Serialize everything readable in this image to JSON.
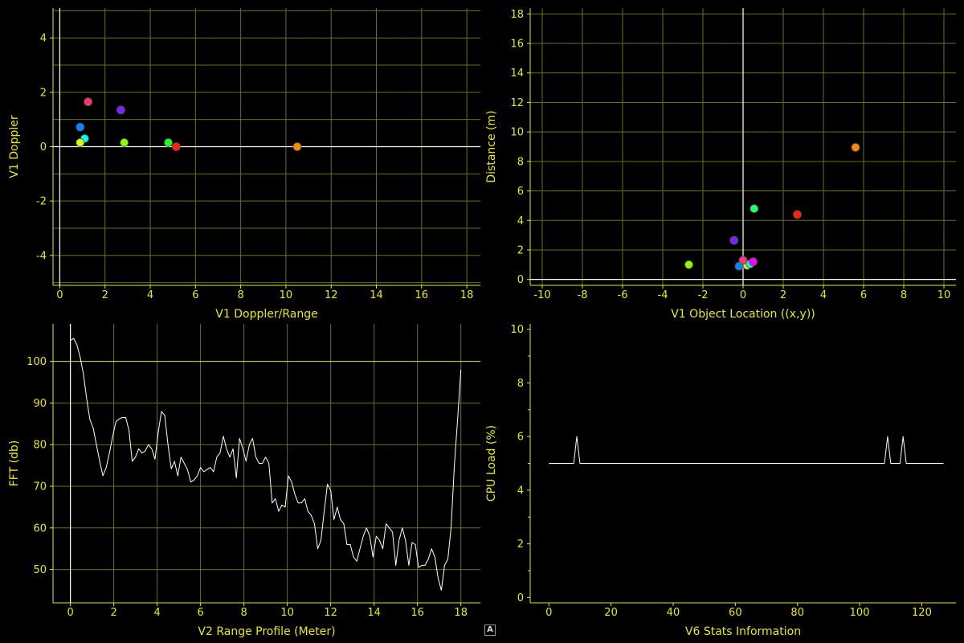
{
  "colors": {
    "axis": "#e8e81a",
    "grid": "#6e6e1e",
    "text": "#e8e81a",
    "background": "#000000",
    "trace": "#ffffff"
  },
  "corner_button": "A",
  "chart_data": [
    {
      "id": "doppler",
      "type": "scatter",
      "xlabel": "V1 Doppler/Range",
      "ylabel": "V1 Doppler",
      "xlim": [
        -0.3,
        18.6
      ],
      "ylim": [
        -5.1,
        5.1
      ],
      "xticks": [
        0,
        2,
        4,
        6,
        8,
        10,
        12,
        14,
        16,
        18
      ],
      "xgrid": [
        0,
        2,
        4,
        6,
        8,
        10,
        12,
        14,
        16,
        18
      ],
      "yticks": [
        -4,
        -2,
        0,
        2,
        4
      ],
      "ygrid": [
        -5,
        -4,
        -3,
        -2,
        -1,
        1,
        2,
        3,
        4,
        5
      ],
      "zero_lines": true,
      "points": [
        {
          "x": 1.25,
          "y": 1.65,
          "color": "#ff3377"
        },
        {
          "x": 2.7,
          "y": 1.35,
          "color": "#7722ff"
        },
        {
          "x": 0.9,
          "y": 0.72,
          "color": "#0088ff"
        },
        {
          "x": 1.1,
          "y": 0.3,
          "color": "#00ffee"
        },
        {
          "x": 0.9,
          "y": 0.15,
          "color": "#ddff00"
        },
        {
          "x": 2.85,
          "y": 0.15,
          "color": "#88ff00"
        },
        {
          "x": 4.8,
          "y": 0.15,
          "color": "#22ff22"
        },
        {
          "x": 5.15,
          "y": 0.0,
          "color": "#ff2200"
        },
        {
          "x": 10.5,
          "y": 0.0,
          "color": "#ff8800"
        }
      ]
    },
    {
      "id": "location",
      "type": "scatter",
      "xlabel": "V1 Object Location ((x,y))",
      "ylabel": "Distance (m)",
      "xlim": [
        -10.6,
        10.6
      ],
      "ylim": [
        -0.4,
        18.4
      ],
      "xticks": [
        -10,
        -8,
        -6,
        -4,
        -2,
        0,
        2,
        4,
        6,
        8,
        10
      ],
      "xgrid": [
        -10,
        -8,
        -6,
        -4,
        -2,
        2,
        4,
        6,
        8,
        10
      ],
      "yticks": [
        0,
        2,
        4,
        6,
        8,
        10,
        12,
        14,
        16,
        18
      ],
      "ygrid": [
        2,
        4,
        6,
        8,
        10,
        12,
        14,
        16,
        18
      ],
      "zero_lines": true,
      "points": [
        {
          "x": 5.6,
          "y": 8.95,
          "color": "#ff8800"
        },
        {
          "x": 0.55,
          "y": 4.8,
          "color": "#22ff66"
        },
        {
          "x": 2.7,
          "y": 4.4,
          "color": "#ff2200"
        },
        {
          "x": -0.45,
          "y": 2.65,
          "color": "#7722ff"
        },
        {
          "x": -2.7,
          "y": 1.0,
          "color": "#88ff00"
        },
        {
          "x": -0.2,
          "y": 0.9,
          "color": "#0088ff"
        },
        {
          "x": 0.2,
          "y": 0.95,
          "color": "#ddff00"
        },
        {
          "x": 0.35,
          "y": 1.05,
          "color": "#00ffee"
        },
        {
          "x": 0.0,
          "y": 1.3,
          "color": "#ff3377"
        },
        {
          "x": 0.5,
          "y": 1.2,
          "color": "#ff00ff"
        }
      ]
    },
    {
      "id": "range_profile",
      "type": "line",
      "xlabel": "V2 Range Profile (Meter)",
      "ylabel": "FFT (db)",
      "xlim": [
        -0.8,
        18.9
      ],
      "ylim": [
        42,
        109
      ],
      "xticks": [
        0,
        2,
        4,
        6,
        8,
        10,
        12,
        14,
        16,
        18
      ],
      "xgrid": [
        0,
        2,
        4,
        6,
        8,
        10,
        12,
        14,
        16,
        18
      ],
      "yticks": [
        50,
        60,
        70,
        80,
        90,
        100
      ],
      "ygrid": [
        50,
        60,
        70,
        80,
        90,
        100
      ],
      "yaxis_at": 0,
      "bright_hline": 100,
      "series": [
        {
          "x": [
            0,
            0.15,
            0.3,
            0.45,
            0.6,
            0.75,
            0.9,
            1.05,
            1.2,
            1.35,
            1.5,
            1.65,
            1.8,
            1.95,
            2.1,
            2.25,
            2.4,
            2.55,
            2.7,
            2.85,
            3.0,
            3.15,
            3.3,
            3.45,
            3.6,
            3.75,
            3.9,
            4.05,
            4.2,
            4.35,
            4.5,
            4.65,
            4.8,
            4.95,
            5.1,
            5.25,
            5.4,
            5.55,
            5.7,
            5.85,
            6.0,
            6.15,
            6.3,
            6.45,
            6.6,
            6.75,
            6.9,
            7.05,
            7.2,
            7.35,
            7.5,
            7.65,
            7.8,
            7.95,
            8.1,
            8.25,
            8.4,
            8.55,
            8.7,
            8.85,
            9.0,
            9.15,
            9.3,
            9.45,
            9.6,
            9.75,
            9.9,
            10.05,
            10.2,
            10.35,
            10.5,
            10.65,
            10.8,
            10.95,
            11.1,
            11.25,
            11.4,
            11.55,
            11.7,
            11.85,
            12.0,
            12.15,
            12.3,
            12.45,
            12.6,
            12.75,
            12.9,
            13.05,
            13.2,
            13.35,
            13.5,
            13.65,
            13.8,
            13.95,
            14.1,
            14.25,
            14.4,
            14.55,
            14.7,
            14.85,
            15.0,
            15.15,
            15.3,
            15.45,
            15.6,
            15.75,
            15.9,
            16.05,
            16.2,
            16.35,
            16.5,
            16.65,
            16.8,
            16.95,
            17.1,
            17.25,
            17.4,
            17.55,
            17.7,
            17.85,
            18.0
          ],
          "values": [
            105,
            105.5,
            104,
            101,
            97,
            91,
            86,
            84,
            80,
            76,
            72.5,
            74.5,
            78,
            82,
            85.5,
            86.2,
            86.5,
            86.5,
            83.5,
            76,
            77,
            79,
            78,
            78.5,
            80,
            79,
            76.5,
            83,
            88,
            87,
            80,
            74.2,
            76,
            72.5,
            77,
            75.5,
            74,
            71,
            71.5,
            72.5,
            74.5,
            73.5,
            74,
            74.5,
            73.5,
            77,
            78,
            82,
            79,
            77,
            79,
            72,
            81.5,
            79,
            76,
            80,
            81.5,
            77,
            75.5,
            75.5,
            77,
            75.5,
            66,
            67,
            64,
            65.5,
            65,
            72.5,
            71,
            68,
            66,
            66,
            67,
            64,
            63,
            61,
            55,
            57,
            64,
            70.5,
            69,
            62,
            65,
            62,
            61,
            56,
            56,
            53,
            52,
            55,
            58,
            60,
            58,
            53,
            58,
            57,
            55,
            61,
            60,
            59,
            51,
            57,
            60,
            57,
            51,
            56.5,
            56,
            50.5,
            51,
            51,
            52.5,
            55,
            53,
            48,
            45,
            51,
            52.5,
            60,
            75,
            86,
            98
          ]
        }
      ]
    },
    {
      "id": "cpu",
      "type": "line",
      "xlabel": "V6 Stats Information",
      "ylabel": "CPU Load (%)",
      "xlim": [
        -6,
        131
      ],
      "ylim": [
        -0.2,
        10.2
      ],
      "xticks": [
        0,
        20,
        40,
        60,
        80,
        100,
        120
      ],
      "yticks": [
        0,
        2,
        4,
        6,
        8,
        10
      ],
      "yminorticks": [
        1,
        3,
        5,
        7,
        9
      ],
      "series": [
        {
          "x": [
            0,
            8,
            9,
            10,
            108,
            109,
            110,
            113,
            114,
            115,
            127
          ],
          "values": [
            5,
            5,
            6,
            5,
            5,
            6,
            5,
            5,
            6,
            5,
            5
          ]
        }
      ]
    }
  ]
}
